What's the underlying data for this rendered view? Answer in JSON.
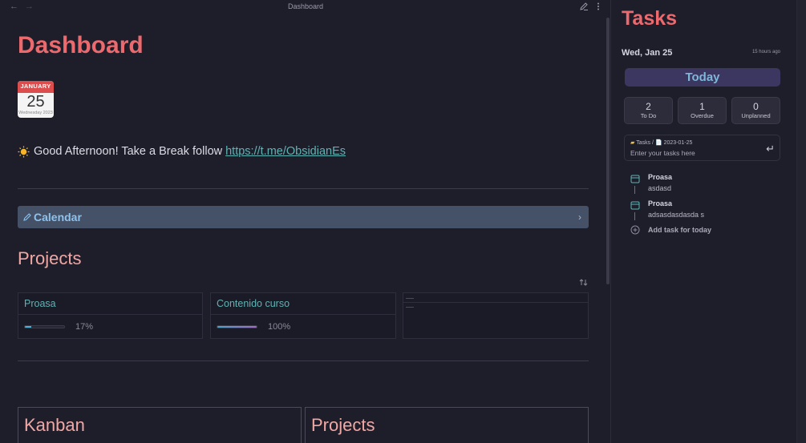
{
  "topbar": {
    "title": "Dashboard"
  },
  "page": {
    "title": "Dashboard",
    "calendar_icon": {
      "month": "JANUARY",
      "day": "25",
      "weekday": "Wednesday 2023"
    },
    "greeting": {
      "text": "Good Afternoon! Take a Break follow",
      "link": "https://t.me/ObsidianEs"
    },
    "callout": {
      "label": "Calendar"
    },
    "projects_heading": "Projects",
    "projects": [
      {
        "name": "Proasa",
        "progress": 0.17,
        "percent_label": "17%"
      },
      {
        "name": "Contenido curso",
        "progress": 1.0,
        "percent_label": "100%"
      }
    ],
    "bottom_cards": [
      {
        "title": "Kanban"
      },
      {
        "title": "Projects"
      }
    ]
  },
  "tasks_panel": {
    "title": "Tasks",
    "date": "Wed, Jan 25",
    "updated": "15 hours ago",
    "today_button": "Today",
    "stats": [
      {
        "value": "2",
        "label": "To Do"
      },
      {
        "value": "1",
        "label": "Overdue"
      },
      {
        "value": "0",
        "label": "Unplanned"
      }
    ],
    "input": {
      "path": "Tasks / 📄 2023-01-25",
      "placeholder": "Enter your tasks here"
    },
    "items": [
      {
        "name": "Proasa",
        "desc": "asdasd"
      },
      {
        "name": "Proasa",
        "desc": "adsasdasdasda s"
      }
    ],
    "add_label": "Add task for today"
  },
  "colors": {
    "accent_red": "#ec6a6d",
    "heading_pink": "#f1a7a3",
    "teal": "#5fb3b3",
    "today_bg": "#3c3760"
  }
}
